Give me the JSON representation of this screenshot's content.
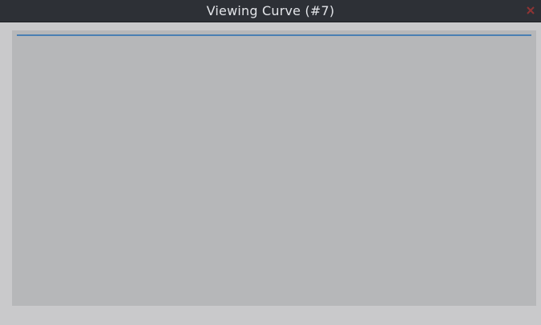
{
  "window": {
    "title": "Viewing Curve (#7)",
    "close_icon": "close-icon",
    "close_color": "#a33a3a"
  },
  "plot": {
    "background_color": "#b6b7b9",
    "curve_color": "#4a7fb3"
  }
}
